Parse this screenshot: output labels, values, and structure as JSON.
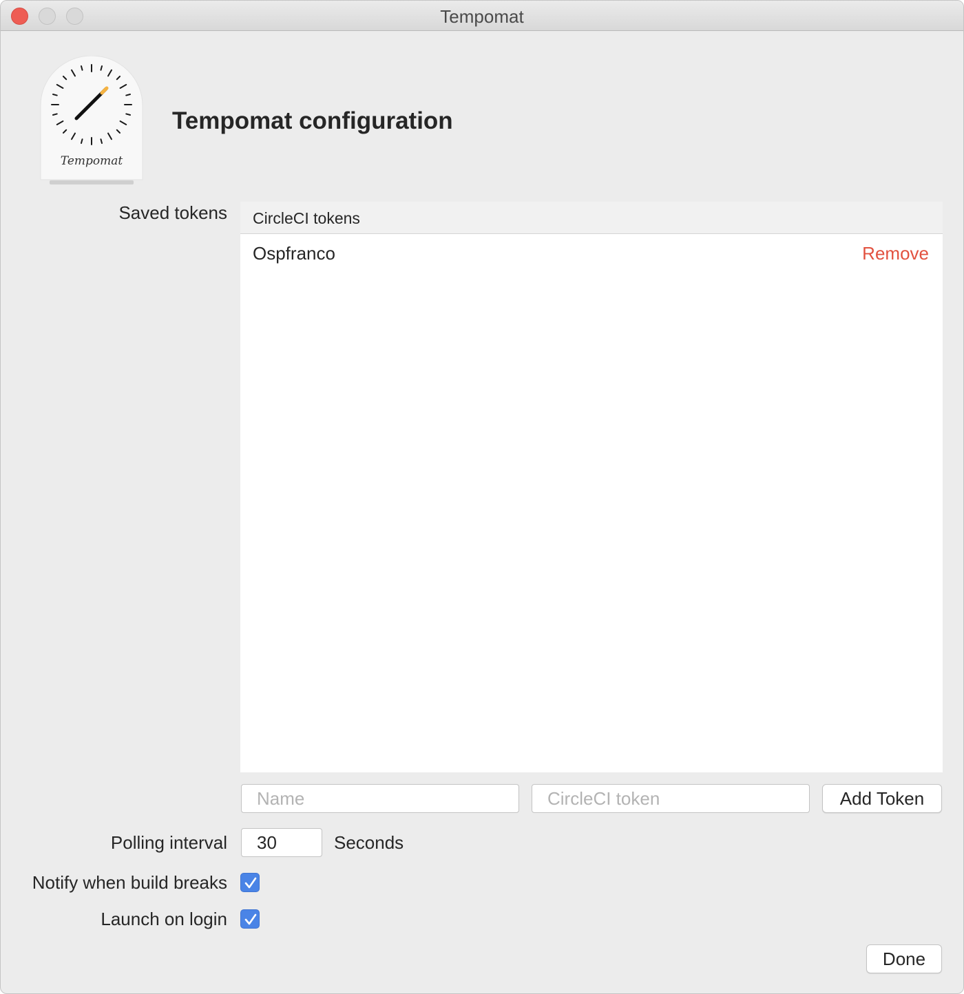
{
  "window": {
    "title": "Tempomat"
  },
  "header": {
    "app_icon_text": "Tempomat",
    "title": "Tempomat configuration"
  },
  "tokens": {
    "label": "Saved tokens",
    "column_header": "CircleCI tokens",
    "rows": [
      {
        "name": "Ospfranco",
        "remove_label": "Remove"
      }
    ]
  },
  "add_token": {
    "name_placeholder": "Name",
    "token_placeholder": "CircleCI token",
    "button_label": "Add Token"
  },
  "polling": {
    "label": "Polling interval",
    "value": "30",
    "unit": "Seconds"
  },
  "options": {
    "notify_label": "Notify when build breaks",
    "notify_checked": true,
    "launch_label": "Launch on login",
    "launch_checked": true
  },
  "footer": {
    "done_label": "Done"
  },
  "colors": {
    "accent": "#4a84e6",
    "remove": "#e2513f"
  }
}
